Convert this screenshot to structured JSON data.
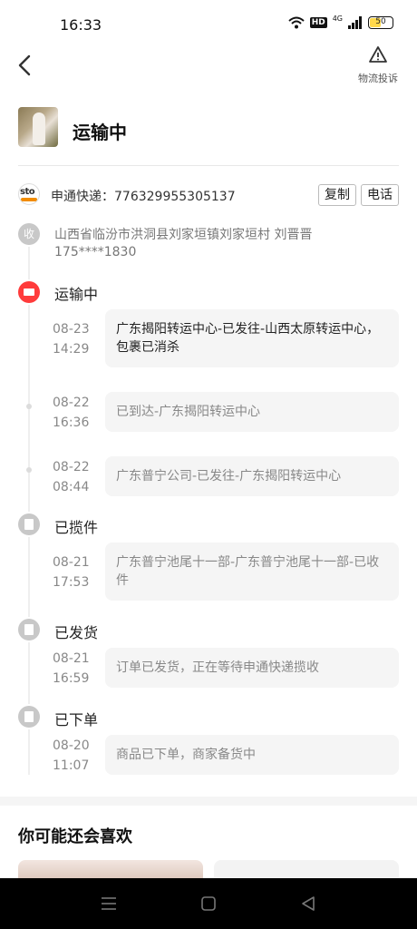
{
  "status_bar": {
    "time": "16:33",
    "battery": "50",
    "network": "4G",
    "hd": "HD"
  },
  "header": {
    "complain_label": "物流投诉"
  },
  "order": {
    "status_title": "运输中"
  },
  "courier": {
    "info": "申通快递：776329955305137",
    "copy_label": "复制",
    "phone_label": "电话",
    "logo_text": "sto"
  },
  "address": {
    "icon_label": "收",
    "line1": "山西省临汾市洪洞县刘家垣镇刘家垣村 刘晋晋",
    "line2": "175****1830"
  },
  "timeline": {
    "stages": [
      {
        "label": "运输中",
        "active": true
      },
      {
        "label": "已揽件"
      },
      {
        "label": "已发货"
      },
      {
        "label": "已下单"
      }
    ],
    "events": [
      {
        "date": "08-23",
        "time": "14:29",
        "text": "广东揭阳转运中心-已发往-山西太原转运中心，包裹已消杀"
      },
      {
        "date": "08-22",
        "time": "16:36",
        "text": "已到达-广东揭阳转运中心"
      },
      {
        "date": "08-22",
        "time": "08:44",
        "text": "广东普宁公司-已发往-广东揭阳转运中心"
      },
      {
        "date": "08-21",
        "time": "17:53",
        "text": "广东普宁池尾十一部-广东普宁池尾十一部-已收件"
      },
      {
        "date": "08-21",
        "time": "16:59",
        "text": "订单已发货，正在等待申通快递揽收"
      },
      {
        "date": "08-20",
        "time": "11:07",
        "text": "商品已下单，商家备货中"
      }
    ]
  },
  "recommend": {
    "title": "你可能还会喜欢"
  },
  "colors": {
    "accent_red": "#ff3b3b",
    "box_bg": "#f5f5f5",
    "muted": "#888888"
  }
}
